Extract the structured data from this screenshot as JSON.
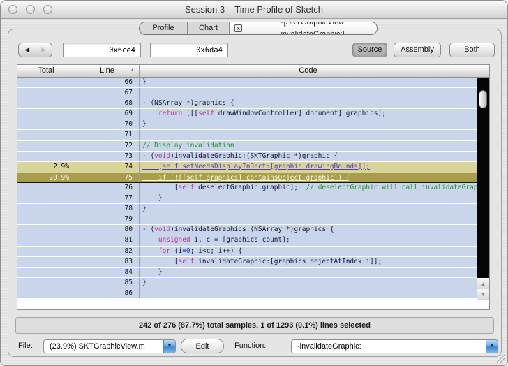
{
  "window": {
    "title": "Session 3 – Time Profile of Sketch"
  },
  "tabs": {
    "items": [
      {
        "label": "Profile"
      },
      {
        "label": "Chart"
      },
      {
        "label": "-[SKTGraphicView invalidateGraphic:]",
        "close_icon": "x"
      }
    ]
  },
  "toolbar": {
    "back_icon": "◀",
    "forward_icon": "▶",
    "address_start": "0x6ce4",
    "address_end": "0x6da4",
    "view_buttons": [
      {
        "label": "Source",
        "selected": true
      },
      {
        "label": "Assembly",
        "selected": false
      },
      {
        "label": "Both",
        "selected": false
      }
    ]
  },
  "table": {
    "columns": [
      {
        "label": "Total"
      },
      {
        "label": "Line",
        "sort": "ascending",
        "sort_icon": "▲"
      },
      {
        "label": "Code"
      }
    ],
    "rows": [
      {
        "line": "66",
        "total": "",
        "style": "normal",
        "segments": [
          [
            "plain",
            "}"
          ]
        ]
      },
      {
        "line": "67",
        "total": "",
        "style": "normal",
        "segments": []
      },
      {
        "line": "68",
        "total": "",
        "style": "normal",
        "segments": [
          [
            "plain",
            "- (NSArray *)graphics {"
          ]
        ]
      },
      {
        "line": "69",
        "total": "",
        "style": "normal",
        "segments": [
          [
            "plain",
            "    "
          ],
          [
            "kw",
            "return"
          ],
          [
            "plain",
            " [[["
          ],
          [
            "kw",
            "self"
          ],
          [
            "plain",
            " drawWindowController] document] graphics];"
          ]
        ]
      },
      {
        "line": "70",
        "total": "",
        "style": "normal",
        "segments": [
          [
            "plain",
            "}"
          ]
        ]
      },
      {
        "line": "71",
        "total": "",
        "style": "normal",
        "segments": []
      },
      {
        "line": "72",
        "total": "",
        "style": "normal",
        "segments": [
          [
            "comment",
            "// Display invalidation"
          ]
        ]
      },
      {
        "line": "73",
        "total": "",
        "style": "normal",
        "segments": [
          [
            "plain",
            "- ("
          ],
          [
            "kw",
            "void"
          ],
          [
            "plain",
            ")invalidateGraphic:(SKTGraphic *)graphic {"
          ]
        ]
      },
      {
        "line": "74",
        "total": "2.9%",
        "style": "khaki",
        "segments": [
          [
            "link",
            "    [self setNeedsDisplayInRect:[graphic drawingBounds]];"
          ]
        ]
      },
      {
        "line": "75",
        "total": "20.9%",
        "style": "selected",
        "segments": [
          [
            "linksel",
            "    if (![[self graphics] containsObject:graphic]) {"
          ]
        ]
      },
      {
        "line": "76",
        "total": "",
        "style": "normal",
        "segments": [
          [
            "plain",
            "        ["
          ],
          [
            "kw",
            "self"
          ],
          [
            "plain",
            " deselectGraphic:graphic];  "
          ],
          [
            "comment",
            "// deselectGraphic will call invalidateGraph…"
          ]
        ]
      },
      {
        "line": "77",
        "total": "",
        "style": "normal",
        "segments": [
          [
            "plain",
            "    }"
          ]
        ]
      },
      {
        "line": "78",
        "total": "",
        "style": "normal",
        "segments": [
          [
            "plain",
            "}"
          ]
        ]
      },
      {
        "line": "79",
        "total": "",
        "style": "normal",
        "segments": []
      },
      {
        "line": "80",
        "total": "",
        "style": "normal",
        "segments": [
          [
            "plain",
            "- ("
          ],
          [
            "kw",
            "void"
          ],
          [
            "plain",
            ")invalidateGraphics:(NSArray *)graphics {"
          ]
        ]
      },
      {
        "line": "81",
        "total": "",
        "style": "normal",
        "segments": [
          [
            "plain",
            "    "
          ],
          [
            "kw",
            "unsigned"
          ],
          [
            "plain",
            " i, c = [graphics count];"
          ]
        ]
      },
      {
        "line": "82",
        "total": "",
        "style": "normal",
        "segments": [
          [
            "plain",
            "    "
          ],
          [
            "kw",
            "for"
          ],
          [
            "plain",
            " (i="
          ],
          [
            "num",
            "0"
          ],
          [
            "plain",
            "; i<c; i++) {"
          ]
        ]
      },
      {
        "line": "83",
        "total": "",
        "style": "normal",
        "segments": [
          [
            "plain",
            "        ["
          ],
          [
            "kw",
            "self"
          ],
          [
            "plain",
            " invalidateGraphic:[graphics objectAtIndex:i]];"
          ]
        ]
      },
      {
        "line": "84",
        "total": "",
        "style": "normal",
        "segments": [
          [
            "plain",
            "    }"
          ]
        ]
      },
      {
        "line": "85",
        "total": "",
        "style": "normal",
        "segments": [
          [
            "plain",
            "}"
          ]
        ]
      },
      {
        "line": "86",
        "total": "",
        "style": "normal",
        "segments": []
      }
    ]
  },
  "scrollbar": {
    "up_icon": "▲",
    "down_icon": "▼"
  },
  "status_bar": {
    "text": "242 of 276 (87.7%) total samples, 1 of 1293 (0.1%) lines selected"
  },
  "footer": {
    "file_label": "File:",
    "file_value": "(23.9%) SKTGraphicView.m",
    "edit_label": "Edit",
    "function_label": "Function:",
    "function_value": "-invalidateGraphic:",
    "popup_icon": "▼"
  },
  "colors": {
    "row_blue": "#c8d5ea",
    "row_khaki": "#d9d49a",
    "row_selected": "#a79d4d",
    "keyword": "#b8399b",
    "comment": "#1e9323",
    "link": "#4a3fbe",
    "popup_button_blue": "#3f87dc"
  }
}
